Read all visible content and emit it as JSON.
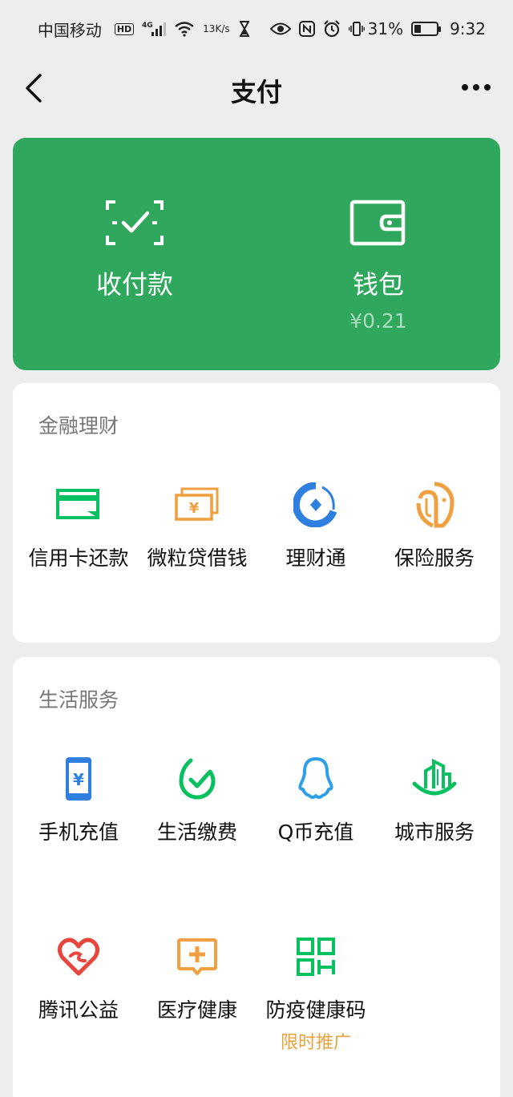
{
  "status_bar": {
    "carrier": "中国移动",
    "hd": "HD",
    "network": "4G",
    "speed_value": "13",
    "speed_unit": "K/s",
    "battery_percent": "31%",
    "battery_level": 0.31,
    "time": "9:32"
  },
  "header": {
    "title": "支付"
  },
  "top_card": {
    "color": "#2fa85d",
    "receive_pay_label": "收付款",
    "wallet_label": "钱包",
    "wallet_balance": "¥0.21"
  },
  "finance": {
    "title": "金融理财",
    "items": [
      {
        "label": "信用卡还款",
        "icon": "credit-card-icon"
      },
      {
        "label": "微粒贷借钱",
        "icon": "loan-cash-icon"
      },
      {
        "label": "理财通",
        "icon": "wealth-icon"
      },
      {
        "label": "保险服务",
        "icon": "insurance-icon"
      }
    ]
  },
  "life": {
    "title": "生活服务",
    "items": [
      {
        "label": "手机充值",
        "icon": "phone-recharge-icon"
      },
      {
        "label": "生活缴费",
        "icon": "bill-payment-icon"
      },
      {
        "label": "Q币充值",
        "icon": "qq-icon"
      },
      {
        "label": "城市服务",
        "icon": "city-icon"
      },
      {
        "label": "腾讯公益",
        "icon": "charity-heart-icon"
      },
      {
        "label": "医疗健康",
        "icon": "medical-icon"
      },
      {
        "label": "防疫健康码",
        "icon": "qr-code-icon",
        "badge": "限时推广"
      }
    ]
  },
  "colors": {
    "brand_green": "#2fa85d",
    "icon_green": "#07c160",
    "icon_orange": "#f0a040",
    "icon_blue": "#2f7fe0",
    "icon_red": "#e8453c",
    "promo_orange": "#e9a23b"
  }
}
